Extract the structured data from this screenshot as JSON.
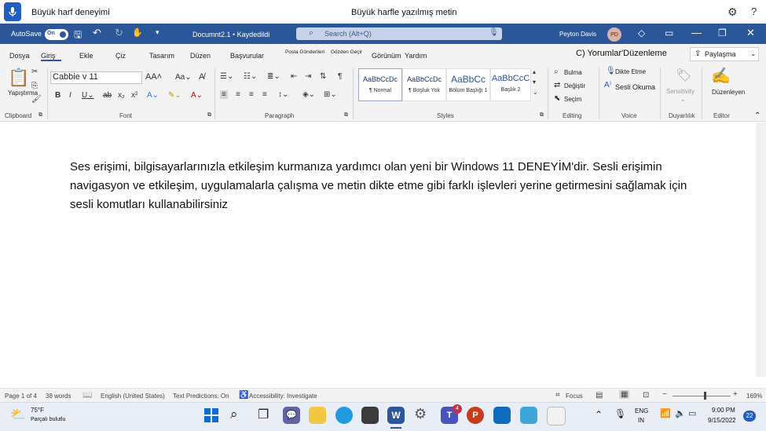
{
  "voice_bar": {
    "title": "Büyük harf deneyimi",
    "status": "Büyük harfle yazılmış metin"
  },
  "title_bar": {
    "autosave_label": "AutoSave",
    "autosave_state": "On",
    "doc_name": "Documnt2.1 • Kaydedildi",
    "search_placeholder": "Search (Alt+Q)",
    "user_name": "Peyton Davis",
    "user_initials": "PD"
  },
  "menu": {
    "tabs": [
      "Dosya",
      "Giriş",
      "Ekle",
      "Çiz",
      "Tasarım",
      "Düzen",
      "Başvurular",
      "Posta Gönderileri",
      "Gözden Geçir",
      "Görünüm",
      "Yardım"
    ],
    "active_tab": "Giriş",
    "comments": "C) Yorumlar'Düzenleme",
    "share": "Paylaşma"
  },
  "ribbon": {
    "clipboard": {
      "paste": "Yapıştırma",
      "group": "Clipboard"
    },
    "font": {
      "name": "Cabbie v 11",
      "group": "Font"
    },
    "paragraph": {
      "group": "Paragraph"
    },
    "styles": {
      "items": [
        {
          "preview": "AaBbCcDc",
          "name": "¶ Normal"
        },
        {
          "preview": "AaBbCcDc",
          "name": "¶ Boşluk Yok"
        },
        {
          "preview": "AaBbCc",
          "name": "Bölüm Başlığı 1"
        },
        {
          "preview": "AaBbCcC",
          "name": "Başlık 2"
        }
      ],
      "group": "Styles"
    },
    "editing": {
      "find": "Bulma",
      "replace": "Değiştir",
      "select": "Seçim",
      "group": "Editing"
    },
    "voice": {
      "dictate": "Dikte Etme",
      "read_aloud": "Sesli Okuma",
      "group": "Voice"
    },
    "sensitivity": {
      "label": "Sensitivity",
      "group": "Duyarlılık"
    },
    "editor": {
      "label": "Düzenleyen",
      "group": "Editor"
    }
  },
  "document": {
    "text": "Ses erişimi, bilgisayarlarınızla etkileşim kurmanıza yardımcı olan yeni bir Windows 11 DENEYİM'dir. Sesli erişimin navigasyon ve etkileşim, uygulamalarla çalışma ve metin dikte etme gibi farklı işlevleri yerine getirmesini sağlamak için sesli komutları kullanabilirsiniz"
  },
  "status_bar": {
    "page": "Page 1 of 4",
    "words": "38 words",
    "language": "English (United States)",
    "predictions": "Text Predictions: On",
    "accessibility": "Accessibility: Investigate",
    "focus": "Focus",
    "zoom": "169%"
  },
  "taskbar": {
    "weather_temp": "75°F",
    "weather_desc": "Parçalı bulutlu",
    "lang_top": "ENG",
    "lang_bottom": "IN",
    "time": "9:00 PM",
    "date": "9/15/2022",
    "notification_count": "22",
    "teams_badge": "4"
  },
  "colors": {
    "word_blue": "#2b579a",
    "accent": "#1f5fbf"
  }
}
